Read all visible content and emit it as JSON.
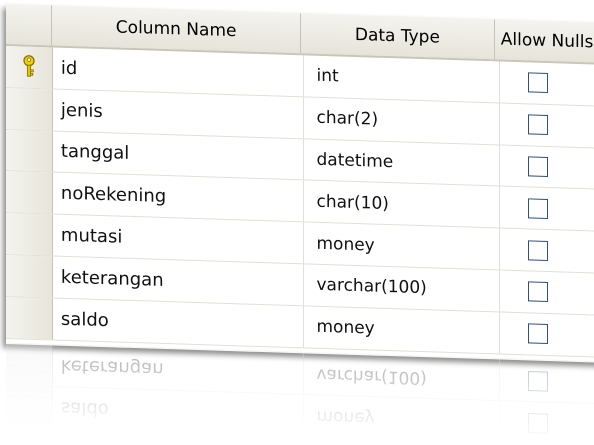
{
  "header": {
    "column_name": "Column Name",
    "data_type": "Data Type",
    "allow_nulls": "Allow Nulls"
  },
  "rows": [
    {
      "name": "id",
      "type": "int",
      "allow_nulls": false,
      "primary_key": true
    },
    {
      "name": "jenis",
      "type": "char(2)",
      "allow_nulls": false
    },
    {
      "name": "tanggal",
      "type": "datetime",
      "allow_nulls": false
    },
    {
      "name": "noRekening",
      "type": "char(10)",
      "allow_nulls": false
    },
    {
      "name": "mutasi",
      "type": "money",
      "allow_nulls": false
    },
    {
      "name": "keterangan",
      "type": "varchar(100)",
      "allow_nulls": false
    },
    {
      "name": "saldo",
      "type": "money",
      "allow_nulls": false
    }
  ],
  "icons": {
    "primary_key": "key-icon"
  },
  "colors": {
    "checkbox_border": "#2d4f78",
    "key": "#e8c400"
  }
}
